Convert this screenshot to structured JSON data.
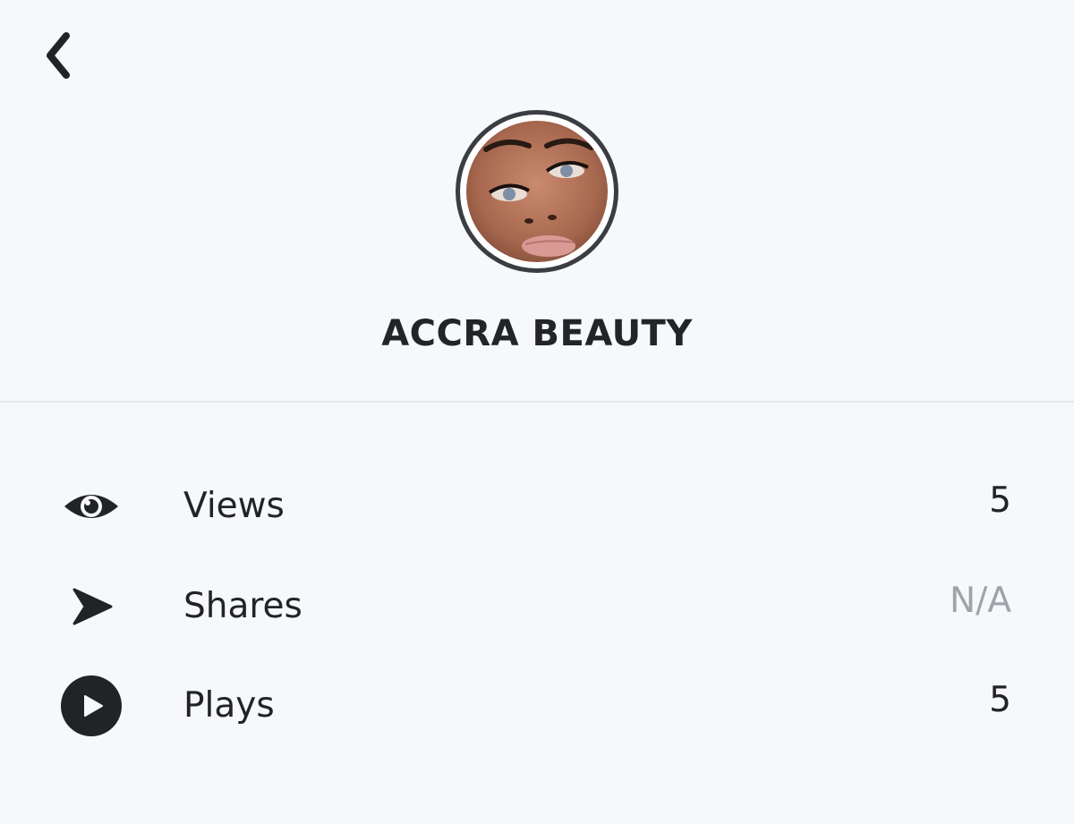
{
  "header": {
    "back_icon": "chevron-left-icon"
  },
  "profile": {
    "name": "ACCRA BEAUTY",
    "avatar": "profile-photo"
  },
  "stats": [
    {
      "icon": "eye-icon",
      "label": "Views",
      "value": "5"
    },
    {
      "icon": "send-arrow-icon",
      "label": "Shares",
      "value": "N/A"
    },
    {
      "icon": "play-circle-icon",
      "label": "Plays",
      "value": "5"
    }
  ],
  "colors": {
    "background": "#f7f8fa",
    "text": "#222326",
    "muted": "#9ea3aa",
    "ring": "#3a3d42",
    "divider": "#e6e7ea"
  }
}
